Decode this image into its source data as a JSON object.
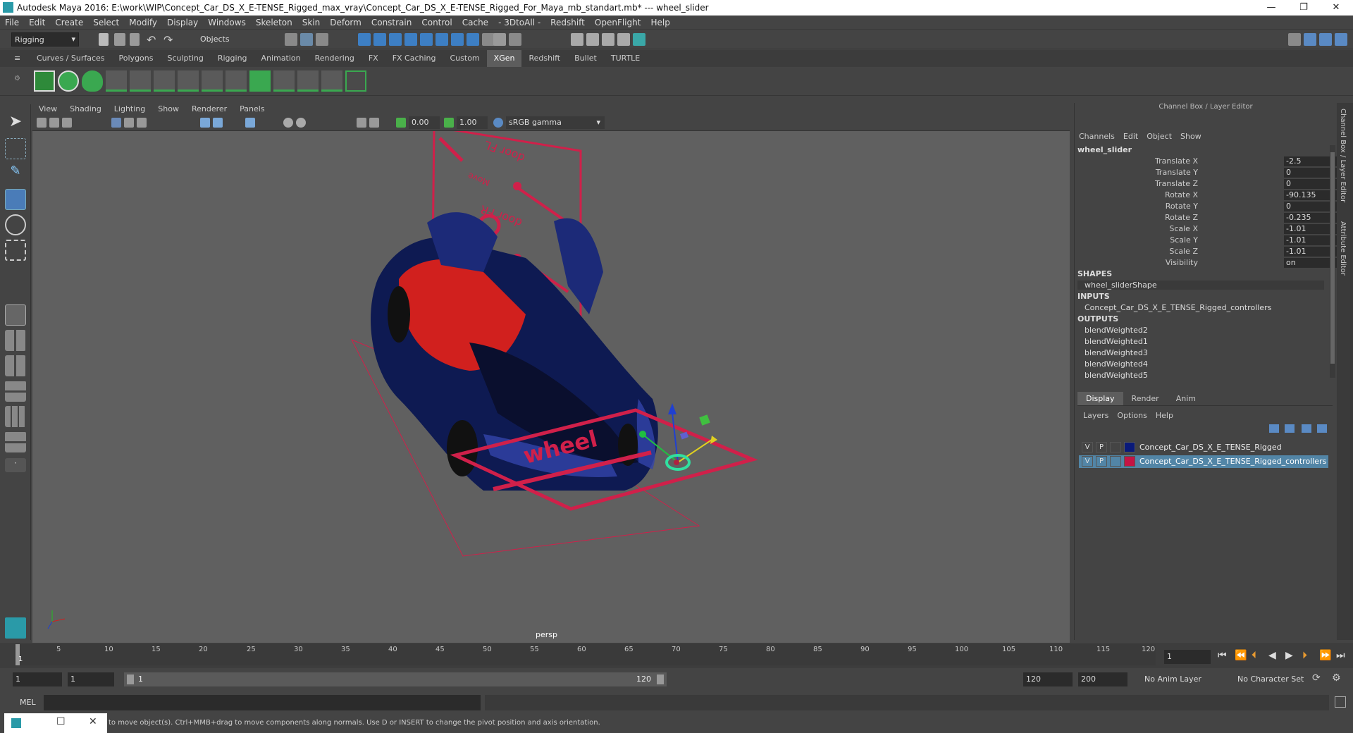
{
  "window": {
    "title": "Autodesk Maya 2016: E:\\work\\WIP\\Concept_Car_DS_X_E-TENSE_Rigged_max_vray\\Concept_Car_DS_X_E-TENSE_Rigged_For_Maya_mb_standart.mb*   ---   wheel_slider",
    "minimize": "—",
    "maximize": "❐",
    "close": "✕"
  },
  "menus": [
    "File",
    "Edit",
    "Create",
    "Select",
    "Modify",
    "Display",
    "Windows",
    "Skeleton",
    "Skin",
    "Deform",
    "Constrain",
    "Control",
    "Cache",
    "- 3DtoAll -",
    "Redshift",
    "OpenFlight",
    "Help"
  ],
  "status": {
    "mode": "Rigging",
    "objects_mode": "Objects"
  },
  "shelf_tabs": [
    {
      "label": "Curves / Surfaces"
    },
    {
      "label": "Polygons"
    },
    {
      "label": "Sculpting"
    },
    {
      "label": "Rigging"
    },
    {
      "label": "Animation"
    },
    {
      "label": "Rendering"
    },
    {
      "label": "FX"
    },
    {
      "label": "FX Caching"
    },
    {
      "label": "Custom"
    },
    {
      "label": "XGen",
      "active": true
    },
    {
      "label": "Redshift"
    },
    {
      "label": "Bullet"
    },
    {
      "label": "TURTLE"
    }
  ],
  "viewport": {
    "menus": [
      "View",
      "Shading",
      "Lighting",
      "Show",
      "Renderer",
      "Panels"
    ],
    "exposure": "0.00",
    "gamma": "1.00",
    "color_space": "sRGB gamma",
    "camera": "persp",
    "label_wheel": "wheel",
    "label_top1": "door FL",
    "label_top2": "door FR",
    "label_top3": "Move"
  },
  "channel_box": {
    "title": "Channel Box / Layer Editor",
    "menus": [
      "Channels",
      "Edit",
      "Object",
      "Show"
    ],
    "object": "wheel_slider",
    "attributes": [
      {
        "label": "Translate X",
        "value": "-2.5"
      },
      {
        "label": "Translate Y",
        "value": "0"
      },
      {
        "label": "Translate Z",
        "value": "0"
      },
      {
        "label": "Rotate X",
        "value": "-90.135"
      },
      {
        "label": "Rotate Y",
        "value": "0"
      },
      {
        "label": "Rotate Z",
        "value": "-0.235"
      },
      {
        "label": "Scale X",
        "value": "-1.01"
      },
      {
        "label": "Scale Y",
        "value": "-1.01"
      },
      {
        "label": "Scale Z",
        "value": "-1.01"
      },
      {
        "label": "Visibility",
        "value": "on"
      }
    ],
    "shapes_header": "SHAPES",
    "shape": "wheel_sliderShape",
    "inputs_header": "INPUTS",
    "input": "Concept_Car_DS_X_E_TENSE_Rigged_controllers",
    "outputs_header": "OUTPUTS",
    "outputs": [
      "blendWeighted2",
      "blendWeighted1",
      "blendWeighted3",
      "blendWeighted4",
      "blendWeighted5"
    ]
  },
  "side_tabs": [
    "Channel Box / Layer Editor",
    "Attribute Editor"
  ],
  "layer_editor": {
    "tabs": [
      {
        "label": "Display",
        "active": true
      },
      {
        "label": "Render"
      },
      {
        "label": "Anim"
      }
    ],
    "menus": [
      "Layers",
      "Options",
      "Help"
    ],
    "layers": [
      {
        "v": "V",
        "p": "P",
        "name": "Concept_Car_DS_X_E_TENSE_Rigged",
        "color": "#0a1a7a",
        "selected": false
      },
      {
        "v": "V",
        "p": "P",
        "name": "Concept_Car_DS_X_E_TENSE_Rigged_controllers",
        "color": "#c41444",
        "selected": true
      }
    ]
  },
  "timeline": {
    "ticks": [
      "1",
      "5",
      "10",
      "15",
      "20",
      "25",
      "30",
      "35",
      "40",
      "45",
      "50",
      "55",
      "60",
      "65",
      "70",
      "75",
      "80",
      "85",
      "90",
      "95",
      "100",
      "105",
      "110",
      "115",
      "120"
    ],
    "current_frame": "1"
  },
  "range": {
    "start": "1",
    "playback_start": "1",
    "slider_start": "1",
    "slider_end": "120",
    "playback_end": "120",
    "end": "200",
    "anim_layer": "No Anim Layer",
    "character_set": "No Character Set"
  },
  "command": {
    "label": "MEL"
  },
  "help_text": "to move object(s). Ctrl+MMB+drag to move components along normals. Use D or INSERT to change the pivot position and axis orientation."
}
